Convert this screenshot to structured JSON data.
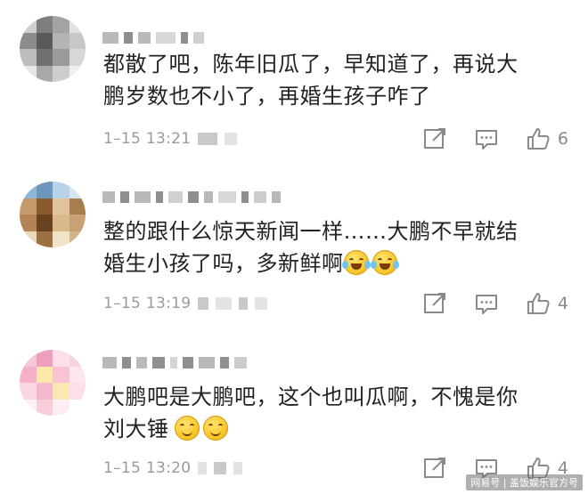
{
  "comments": [
    {
      "text_line1": "都散了吧，陈年旧瓜了，早知道了，再说大",
      "text_line2": "鹏岁数也不小了，再婚生孩子咋了",
      "time": "1–15 13:21",
      "likes": "6"
    },
    {
      "text_line1": "整的跟什么惊天新闻一样……大鹏不早就结",
      "text_line2": "婚生小孩了吗，多新鲜啊",
      "emojis": [
        "laughing-crying-emoji",
        "laughing-crying-emoji"
      ],
      "time": "1–15 13:19",
      "likes": "4"
    },
    {
      "text_line1": "大鹏吧是大鹏吧，这个也叫瓜啊，不愧是你",
      "text_line2": "刘大锤",
      "emojis": [
        "smile-emoji",
        "smile-emoji"
      ],
      "time": "1–15 13:20",
      "likes": "4"
    }
  ],
  "icons": {
    "share": "share-icon",
    "comment": "comment-icon",
    "like": "thumbs-up-icon"
  },
  "colors": {
    "text": "#222222",
    "meta": "#9a9a9a",
    "icon": "#8a8a8a"
  },
  "watermark": "网易号 | 盖饭娱乐官方号"
}
